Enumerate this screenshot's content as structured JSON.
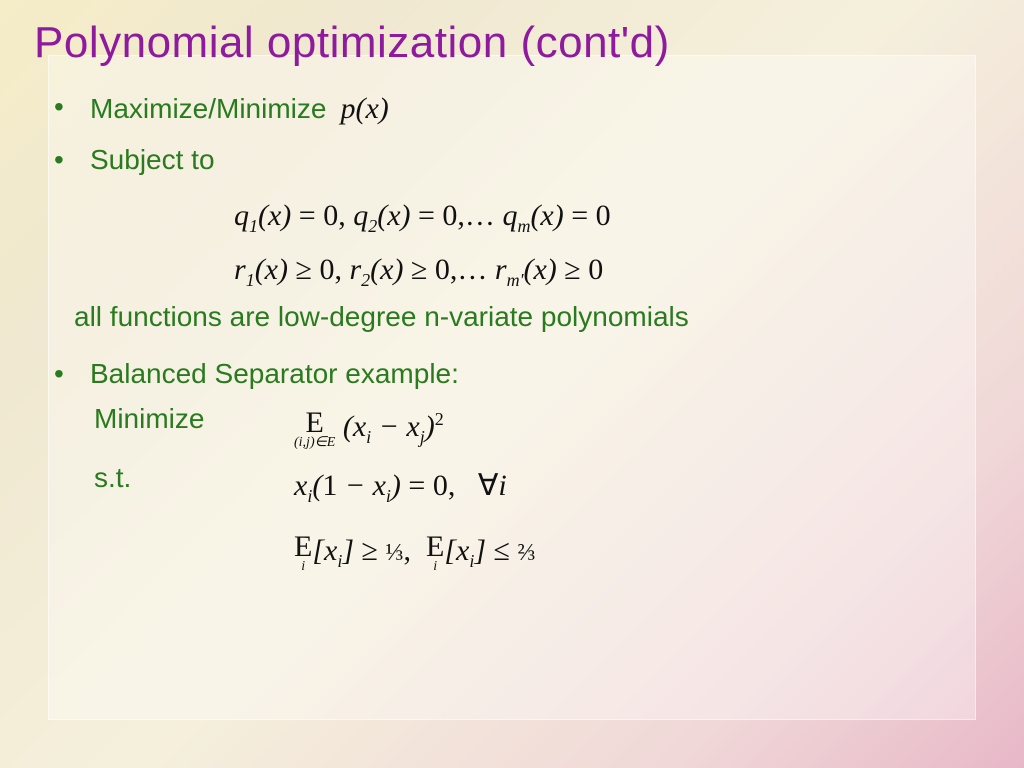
{
  "title": "Polynomial optimization (cont'd)",
  "bullets": {
    "b1_label": "Maximize/Minimize",
    "b1_math": "p(x)",
    "b2_label": "Subject to",
    "eq_line1_html": "q<span class='sub'>1</span>(x) <span class='upright'>= 0,</span> q<span class='sub'>2</span>(x) <span class='upright'>= 0,…</span> q<span class='sub'>m</span>(x) <span class='upright'>= 0</span>",
    "eq_line2_html": "r<span class='sub'>1</span>(x) <span class='upright'>≥ 0,</span> r<span class='sub'>2</span>(x) <span class='upright'>≥ 0,…</span> r<span class='sub'>m'</span>(x) <span class='upright'>≥ 0</span>",
    "note": "all functions are low-degree n-variate polynomials",
    "b3_label": "Balanced Separator example:",
    "ex_min_label": "Minimize",
    "ex_min_math_html": "<span class='expect'><span class='etop'>E</span><span class='ebot'>(i,j)∈E</span></span> (x<span class='sub'>i</span> − x<span class='sub'>j</span>)<span class='sup'>2</span>",
    "ex_st_label": "s.t.",
    "ex_st1_html": "x<span class='sub'>i</span>(<span class='upright'>1</span> − x<span class='sub'>i</span>) <span class='upright'>= 0,</span>&nbsp;&nbsp;&nbsp;<span class='upright'>∀</span>i",
    "ex_st2_html": "<span class='expect'><span class='etop'>E</span><span class='ebot'>i</span></span>[x<span class='sub'>i</span>] <span class='upright'>≥</span> <span class='upright frac'>⅓</span><span class='upright'>,</span>&nbsp;&nbsp;<span class='expect'><span class='etop'>E</span><span class='ebot'>i</span></span>[x<span class='sub'>i</span>] <span class='upright'>≤</span> <span class='upright frac'>⅔</span>"
  }
}
